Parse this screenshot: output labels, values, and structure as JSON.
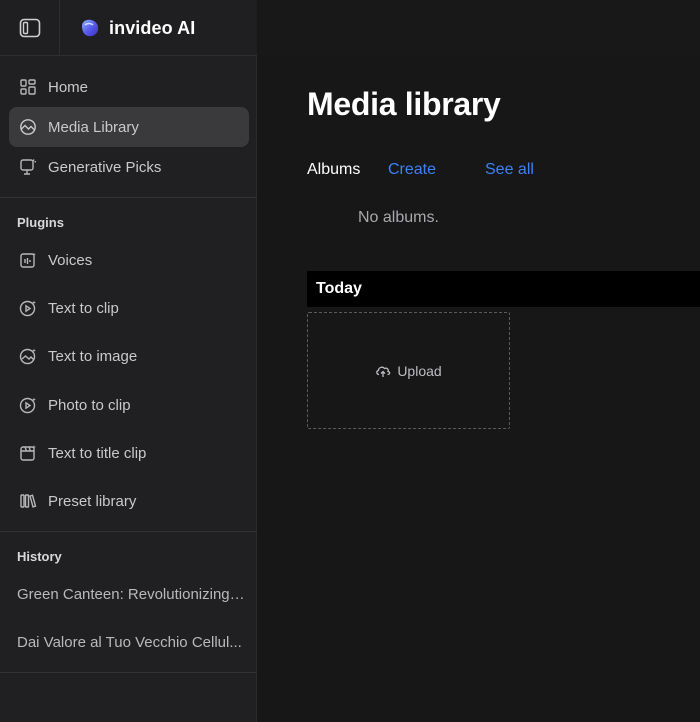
{
  "app": {
    "brand": "invideo AI",
    "accent_color": "#3b82f6"
  },
  "sidebar": {
    "toggle_icon": "sidebar-toggle-icon",
    "nav": [
      {
        "label": "Home",
        "icon": "grid-icon",
        "active": false
      },
      {
        "label": "Media Library",
        "icon": "image-icon",
        "active": true
      },
      {
        "label": "Generative Picks",
        "icon": "generative-picks-icon",
        "active": false
      }
    ],
    "plugins_title": "Plugins",
    "plugins": [
      {
        "label": "Voices",
        "icon": "voice-icon"
      },
      {
        "label": "Text to clip",
        "icon": "text-to-clip-icon"
      },
      {
        "label": "Text to image",
        "icon": "text-to-image-icon"
      },
      {
        "label": "Photo to clip",
        "icon": "photo-to-clip-icon"
      },
      {
        "label": "Text to title clip",
        "icon": "title-clip-icon"
      },
      {
        "label": "Preset library",
        "icon": "library-icon"
      }
    ],
    "history_title": "History",
    "history": [
      "Green Canteen: Revolutionizing ...",
      "Dai Valore al Tuo Vecchio Cellul..."
    ]
  },
  "main": {
    "title": "Media library",
    "albums_label": "Albums",
    "create_label": "Create",
    "see_all_label": "See all",
    "no_albums_text": "No albums.",
    "today_label": "Today",
    "upload_label": "Upload"
  }
}
